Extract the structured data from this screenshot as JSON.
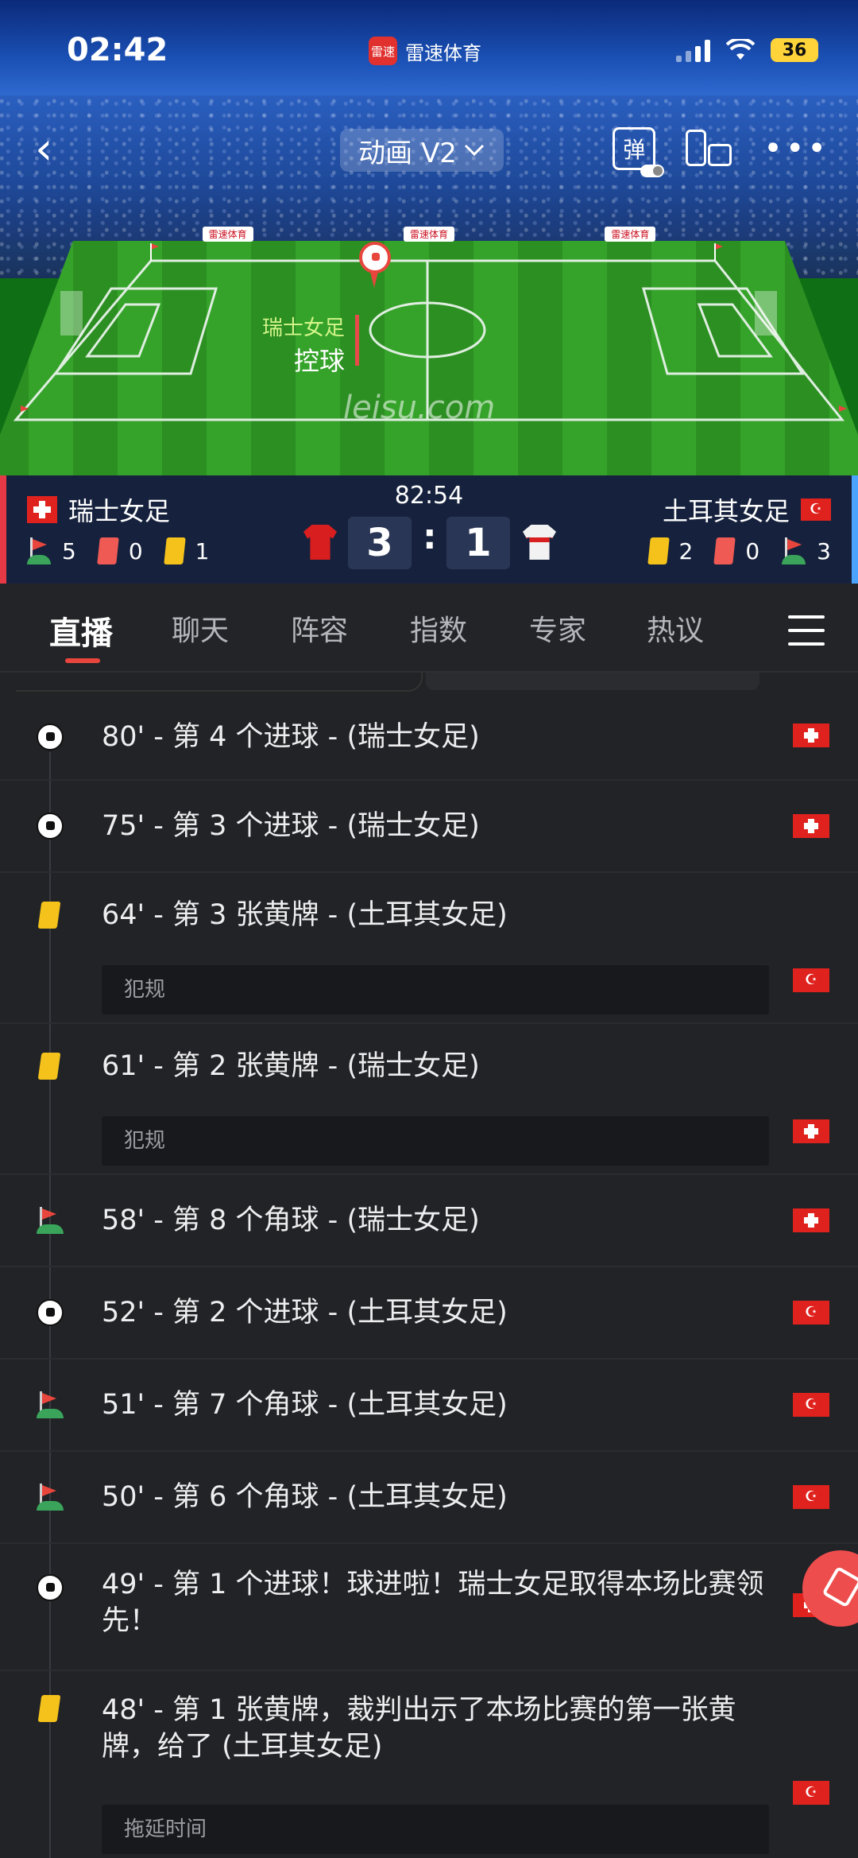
{
  "status_bar": {
    "time": "02:42",
    "app_name": "雷速体育",
    "app_logo_text": "雷速",
    "battery": "36"
  },
  "top_bar": {
    "mode_label": "动画 V2",
    "danmaku_label": "弹"
  },
  "pitch": {
    "possession_team": "瑞士女足",
    "possession_label": "控球",
    "watermark": "leisu.com",
    "ad_text": "雷速体育"
  },
  "match": {
    "clock": "82:54",
    "home": {
      "name": "瑞士女足",
      "corners": "5",
      "red": "0",
      "yellow": "1",
      "score": "3"
    },
    "away": {
      "name": "土耳其女足",
      "corners": "3",
      "red": "0",
      "yellow": "2",
      "score": "1"
    }
  },
  "tabs": [
    {
      "label": "直播"
    },
    {
      "label": "聊天"
    },
    {
      "label": "阵容"
    },
    {
      "label": "指数"
    },
    {
      "label": "专家"
    },
    {
      "label": "热议"
    }
  ],
  "events": [
    {
      "icon": "soccer-ball-icon",
      "text": "80' - 第 4 个进球 - (瑞士女足)",
      "team_flag": "swiss-flag-icon",
      "note": ""
    },
    {
      "icon": "soccer-ball-icon",
      "text": "75' - 第 3 个进球 - (瑞士女足)",
      "team_flag": "swiss-flag-icon",
      "note": ""
    },
    {
      "icon": "yellow-card-icon",
      "text": "64' - 第 3 张黄牌 - (土耳其女足)",
      "team_flag": "turkey-flag-icon",
      "note": "犯规"
    },
    {
      "icon": "yellow-card-icon",
      "text": "61' - 第 2 张黄牌 - (瑞士女足)",
      "team_flag": "swiss-flag-icon",
      "note": "犯规"
    },
    {
      "icon": "corner-flag-icon",
      "text": "58' - 第 8 个角球 - (瑞士女足)",
      "team_flag": "swiss-flag-icon",
      "note": ""
    },
    {
      "icon": "soccer-ball-icon",
      "text": "52' - 第 2 个进球 - (土耳其女足)",
      "team_flag": "turkey-flag-icon",
      "note": ""
    },
    {
      "icon": "corner-flag-icon",
      "text": "51' - 第 7 个角球 - (土耳其女足)",
      "team_flag": "turkey-flag-icon",
      "note": ""
    },
    {
      "icon": "corner-flag-icon",
      "text": "50' - 第 6 个角球 - (土耳其女足)",
      "team_flag": "turkey-flag-icon",
      "note": ""
    },
    {
      "icon": "soccer-ball-icon",
      "text": "49' - 第 1 个进球！球进啦！瑞士女足取得本场比赛领先！",
      "team_flag": "swiss-flag-icon",
      "note": ""
    },
    {
      "icon": "yellow-card-icon",
      "text": "48' - 第 1 张黄牌，裁判出示了本场比赛的第一张黄牌，给了 (土耳其女足)",
      "team_flag": "turkey-flag-icon",
      "note": "拖延时间"
    }
  ],
  "colors": {
    "accent": "#e8463d",
    "home_edge": "#e63946",
    "away_edge": "#4aa3ff",
    "yellow": "#f4c21b"
  }
}
